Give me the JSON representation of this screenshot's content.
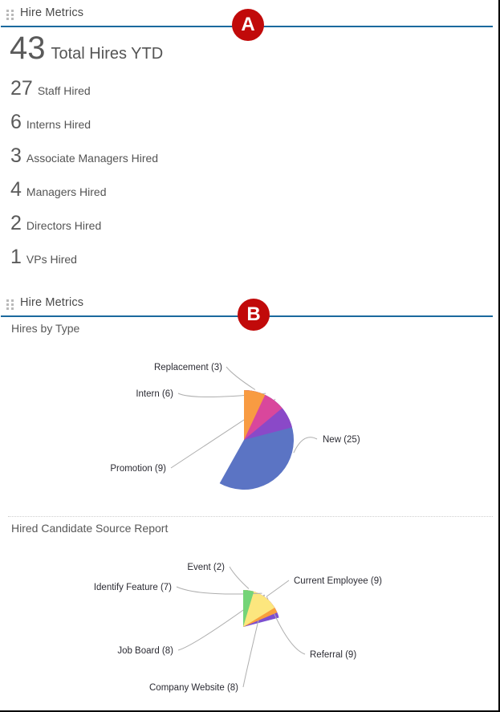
{
  "panels": [
    {
      "title": "Hire Metrics",
      "badge": "A",
      "grip_icon": "drag-handle-icon",
      "accent_color": "#1a699e"
    },
    {
      "title": "Hire Metrics",
      "badge": "B",
      "grip_icon": "drag-handle-icon",
      "accent_color": "#1a699e"
    }
  ],
  "badge_color": "#c10a0a",
  "kpis": {
    "hero": {
      "value": "43",
      "label": "Total Hires YTD"
    },
    "rows": [
      {
        "value": "27",
        "label": "Staff Hired"
      },
      {
        "value": "6",
        "label": "Interns Hired"
      },
      {
        "value": "3",
        "label": "Associate Managers Hired"
      },
      {
        "value": "4",
        "label": "Managers Hired"
      },
      {
        "value": "2",
        "label": "Directors Hired"
      },
      {
        "value": "1",
        "label": "VPs Hired"
      }
    ]
  },
  "chart_data": [
    {
      "type": "pie",
      "title": "Hires by Type",
      "categories": [
        "New",
        "Promotion",
        "Intern",
        "Replacement"
      ],
      "values": [
        25,
        9,
        6,
        3
      ],
      "labels": [
        "New (25)",
        "Promotion (9)",
        "Intern (6)",
        "Replacement (3)"
      ],
      "colors": [
        "#5b74c4",
        "#8a49c8",
        "#d9479c",
        "#f89b42"
      ],
      "total": 43,
      "legend": "callout-labels",
      "start_angle_deg": 0,
      "direction": "clockwise"
    },
    {
      "type": "pie",
      "title": "Hired Candidate Source Report",
      "categories": [
        "Current Employee",
        "Referral",
        "Company Website",
        "Job Board",
        "Identify Feature",
        "Event"
      ],
      "values": [
        9,
        9,
        8,
        8,
        7,
        2
      ],
      "labels": [
        "Current Employee (9)",
        "Referral (9)",
        "Company Website (8)",
        "Job Board (8)",
        "Identify Feature (7)",
        "Event (2)"
      ],
      "colors": [
        "#5470c6",
        "#7e4fd0",
        "#e04ba8",
        "#f9a03c",
        "#fce67e",
        "#74d477"
      ],
      "total": 43,
      "legend": "callout-labels",
      "start_angle_deg": 0,
      "direction": "clockwise"
    }
  ]
}
